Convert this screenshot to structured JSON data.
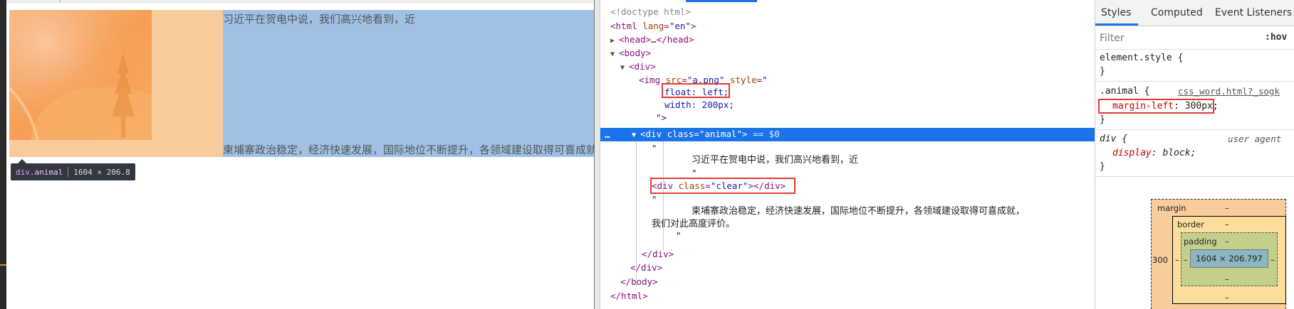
{
  "page": {
    "text_line_1": "习近平在贺电中说，我们高兴地看到，近",
    "text_line_2": "柬埔寨政治稳定，经济快速发展，国际地位不断提升，各领域建设取得可喜成就，我们对此高度评价。"
  },
  "tooltip": {
    "tag": "div",
    "class": ".animal",
    "size": "1604 × 206.8"
  },
  "elements": {
    "doctype": "<!doctype html>",
    "html_open_tag": "html",
    "lang_attr": "lang",
    "lang_val": "\"en\"",
    "head": "head",
    "head_ellipsis": "…",
    "body": "body",
    "div": "div",
    "img_tag": "img",
    "src_attr": "src",
    "src_val": "\"a.png\"",
    "style_attr": "style",
    "style_open": "\"",
    "float_decl": "float: left;",
    "width_decl": "width: 200px;",
    "style_close": "\">",
    "class_attr": "class",
    "animal_val": "\"animal\"",
    "selected_marker": "== $0",
    "dots": "…",
    "quote": "\"",
    "text_1": "习近平在贺电中说，我们高兴地看到，近",
    "clear_val": "\"clear\"",
    "text_2a": "柬埔寨政治稳定，经济快速发展，国际地位不断提升，各领域建设取得可喜成就，",
    "text_2b": "我们对此高度评价。",
    "close_div": "</div>",
    "close_body": "</body>",
    "close_html": "</html>"
  },
  "styles": {
    "tabs": [
      "Styles",
      "Computed",
      "Event Listeners"
    ],
    "filter_placeholder": "Filter",
    "hov": ":hov",
    "element_style": "element.style {",
    "close_brace": "}",
    "animal_selector": ".animal {",
    "animal_source": "css_word.html?_sogk",
    "margin_left_prop": "margin-left",
    "margin_left_val": "300px;",
    "div_selector": "div {",
    "user_agent": "user agent",
    "display_prop": "display",
    "display_val": "block;"
  },
  "box_model": {
    "margin_label": "margin",
    "border_label": "border",
    "padding_label": "padding",
    "dash": "–",
    "margin_left": "300",
    "content_size": "1604 × 206.797"
  },
  "colors": {
    "margin_highlight": "#f8cb9c",
    "content_highlight": "#9fc1e6",
    "selection_blue": "#1a73e8",
    "red_box": "#e53935"
  }
}
